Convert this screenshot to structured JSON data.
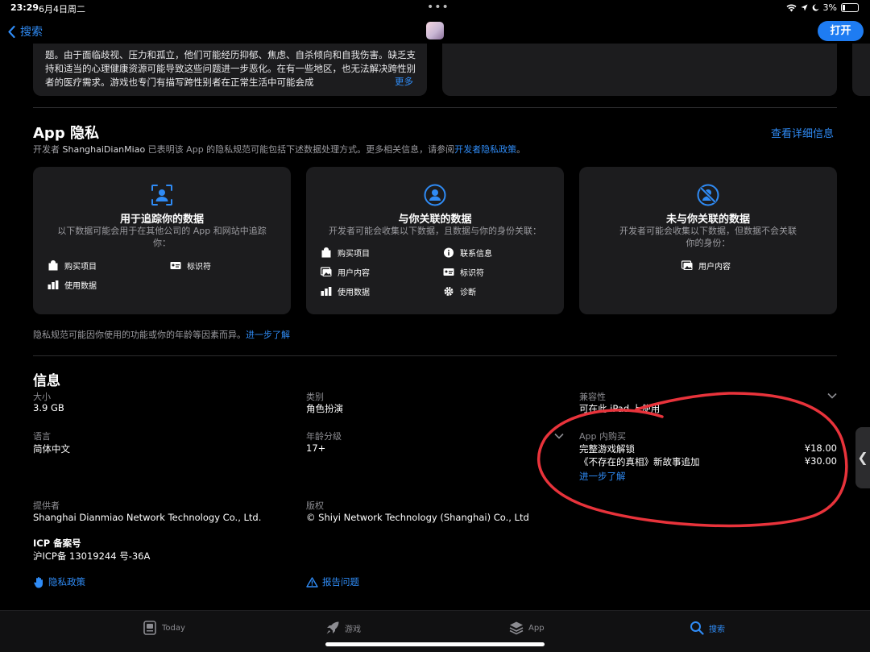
{
  "status_bar": {
    "time": "23:29",
    "date": "6月4日周二",
    "battery": "3%",
    "dots": "•••"
  },
  "nav": {
    "back_label": "搜索",
    "open_label": "打开"
  },
  "description": {
    "text": "题。由于面临歧视、压力和孤立，他们可能经历抑郁、焦虑、自杀倾向和自我伤害。缺乏支持和适当的心理健康资源可能导致这些问题进一步恶化。在有一些地区，也无法解决跨性别者的医疗需求。游戏也专门有描写跨性别者在正常生活中可能会成",
    "more": "更多"
  },
  "privacy": {
    "title": "App 隐私",
    "details_link": "查看详细信息",
    "desc_prefix": "开发者 ",
    "developer": "ShanghaiDianMiao",
    "desc_middle": " 已表明该 App 的隐私规范可能包括下述数据处理方式。更多相关信息，请参阅",
    "policy_link": "开发者隐私政策",
    "desc_suffix": "。",
    "cards": [
      {
        "title": "用于追踪你的数据",
        "desc": "以下数据可能会用于在其他公司的 App 和网站中追踪你：",
        "items": [
          "购买项目",
          "标识符",
          "使用数据"
        ]
      },
      {
        "title": "与你关联的数据",
        "desc": "开发者可能会收集以下数据，且数据与你的身份关联：",
        "items": [
          "购买项目",
          "联系信息",
          "用户内容",
          "标识符",
          "使用数据",
          "诊断"
        ]
      },
      {
        "title": "未与你关联的数据",
        "desc": "开发者可能会收集以下数据，但数据不会关联你的身份：",
        "items": [
          "用户内容"
        ]
      }
    ],
    "note": "隐私规范可能因你使用的功能或你的年龄等因素而异。",
    "note_link": "进一步了解"
  },
  "info": {
    "title": "信息",
    "size": {
      "label": "大小",
      "value": "3.9 GB"
    },
    "category": {
      "label": "类别",
      "value": "角色扮演"
    },
    "compat": {
      "label": "兼容性",
      "value": "可在此 iPad 上使用"
    },
    "language": {
      "label": "语言",
      "value": "简体中文"
    },
    "age": {
      "label": "年龄分级",
      "value": "17+"
    },
    "iap": {
      "label": "App 内购买",
      "items": [
        {
          "name": "完整游戏解锁",
          "price": "¥18.00"
        },
        {
          "name": "《不存在的真相》新故事追加",
          "price": "¥30.00"
        }
      ],
      "more": "进一步了解"
    },
    "provider": {
      "label": "提供者",
      "value": "Shanghai Dianmiao Network Technology Co., Ltd."
    },
    "copyright": {
      "label": "版权",
      "value": "© Shiyi Network Technology (Shanghai) Co., Ltd"
    },
    "icp": {
      "label": "ICP 备案号",
      "value": "沪ICP备 13019244 号-36A"
    },
    "privacy_policy": "隐私政策",
    "report": "报告问题"
  },
  "tabs": [
    "Today",
    "游戏",
    "App",
    "搜索"
  ],
  "colors": {
    "accent": "#2f8bf5",
    "background": "#000000",
    "card": "#1c1c1e",
    "annotation": "#e8333b"
  }
}
